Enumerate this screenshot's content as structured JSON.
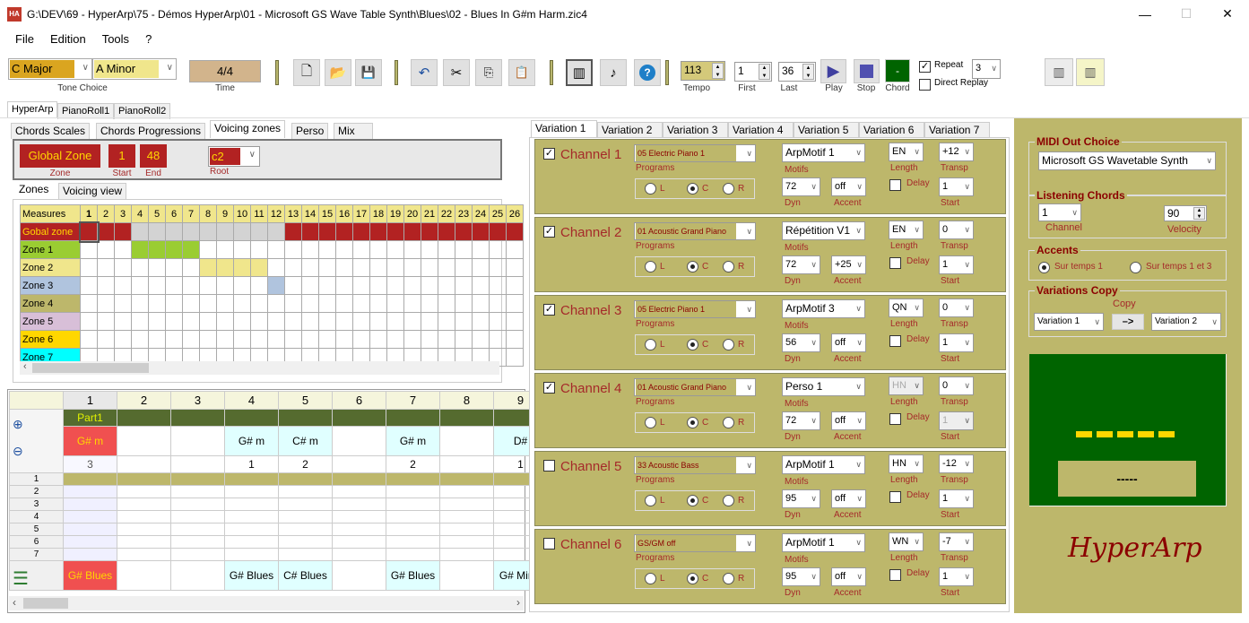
{
  "window": {
    "title": "G:\\DEV\\69 - HyperArp\\75 - Démos HyperArp\\01  - Microsoft GS Wave Table Synth\\Blues\\02 - Blues In G#m Harm.zic4",
    "icon_text": "HA",
    "minimize": "—",
    "maximize": "☐",
    "close": "✕"
  },
  "menu": [
    "File",
    "Edition",
    "Tools",
    "?"
  ],
  "toolbar": {
    "tone_major": "C Major",
    "tone_minor": "A Minor",
    "tone_label": "Tone Choice",
    "time_value": "4/4",
    "time_label": "Time",
    "tempo_value": "113",
    "tempo_label": "Tempo",
    "first_value": "1",
    "first_label": "First",
    "last_value": "36",
    "last_label": "Last",
    "play_label": "Play",
    "stop_label": "Stop",
    "chord_label": "Chord",
    "chord_value": "-",
    "repeat_label": "Repeat",
    "repeat_checked": true,
    "repeat_count": "3",
    "direct_replay_label": "Direct Replay",
    "direct_replay_checked": false
  },
  "main_tabs": [
    "HyperArp",
    "PianoRoll1",
    "PianoRoll2"
  ],
  "sub_tabs": [
    "Chords Scales",
    "Chords Progressions",
    "Voicing zones",
    "Perso",
    "Mix"
  ],
  "voicing": {
    "zone_value": "Global Zone",
    "zone_label": "Zone",
    "start_value": "1",
    "start_label": "Start",
    "end_value": "48",
    "end_label": "End",
    "root_value": "c2",
    "root_label": "Root",
    "view_tabs": [
      "Zones",
      "Voicing view"
    ],
    "measures_label": "Measures",
    "measures": [
      "1",
      "2",
      "3",
      "4",
      "5",
      "6",
      "7",
      "8",
      "9",
      "10",
      "11",
      "12",
      "13",
      "14",
      "15",
      "16",
      "17",
      "18",
      "19",
      "20",
      "21",
      "22",
      "23",
      "24",
      "25",
      "26"
    ],
    "zones": [
      {
        "name": "Gobal zone",
        "color": "#b22222",
        "text_color": "#ffd700",
        "fill": [
          1,
          2,
          3,
          13,
          14,
          15,
          16,
          17,
          18,
          19,
          20,
          21,
          22,
          23,
          24,
          25,
          26
        ],
        "grey": [
          4,
          5,
          6,
          7,
          8,
          9,
          10,
          11,
          12
        ]
      },
      {
        "name": "Zone  1",
        "color": "#9acd32",
        "text_color": "#000",
        "fill": [
          4,
          5,
          6,
          7
        ],
        "grey": []
      },
      {
        "name": "Zone  2",
        "color": "#f0e68c",
        "text_color": "#000",
        "fill": [
          8,
          9,
          10,
          11
        ],
        "grey": []
      },
      {
        "name": "Zone  3",
        "color": "#b0c4de",
        "text_color": "#000",
        "fill": [
          12
        ],
        "grey": []
      },
      {
        "name": "Zone  4",
        "color": "#bdb76b",
        "text_color": "#000",
        "fill": [],
        "grey": []
      },
      {
        "name": "Zone  5",
        "color": "#d8bfd8",
        "text_color": "#000",
        "fill": [],
        "grey": []
      },
      {
        "name": "Zone  6",
        "color": "#ffd700",
        "text_color": "#000",
        "fill": [],
        "grey": []
      },
      {
        "name": "Zone  7",
        "color": "#00ffff",
        "text_color": "#000",
        "fill": [],
        "grey": []
      }
    ]
  },
  "chord_grid": {
    "columns": [
      "1",
      "2",
      "3",
      "4",
      "5",
      "6",
      "7",
      "8",
      "9"
    ],
    "part_label": "Part1",
    "chords": [
      "G# m",
      "",
      "",
      "G# m",
      "C# m",
      "",
      "G# m",
      "",
      "D#"
    ],
    "counts": [
      "3",
      "",
      "",
      "1",
      "2",
      "",
      "2",
      "",
      "1"
    ],
    "rows": [
      "1",
      "2",
      "3",
      "4",
      "5",
      "6",
      "7"
    ],
    "scales": [
      "G# Blues",
      "",
      "",
      "G# Blues",
      "C# Blues",
      "",
      "G# Blues",
      "",
      "G# MinH"
    ]
  },
  "variations": {
    "tabs": [
      "Variation 1",
      "Variation 2",
      "Variation 3",
      "Variation 4",
      "Variation 5",
      "Variation 6",
      "Variation 7"
    ],
    "labels": {
      "programs": "Programs",
      "motifs": "Motifs",
      "length": "Length",
      "transp": "Transp",
      "dyn": "Dyn",
      "accent": "Accent",
      "delay": "Delay",
      "start": "Start",
      "l": "L",
      "c": "C",
      "r": "R"
    },
    "channels": [
      {
        "name": "Channel 1",
        "checked": true,
        "program": "05 Electric Piano 1",
        "motif": "ArpMotif 1",
        "length": "EN",
        "transp": "+12",
        "dyn": "72",
        "accent": "off",
        "start": "1",
        "pan": "C",
        "delay": false,
        "length_disabled": false,
        "start_disabled": false
      },
      {
        "name": "Channel 2",
        "checked": true,
        "program": "01 Acoustic Grand Piano",
        "motif": "Répétition V1",
        "length": "EN",
        "transp": "0",
        "dyn": "72",
        "accent": "+25",
        "start": "1",
        "pan": "C",
        "delay": false,
        "length_disabled": false,
        "start_disabled": false
      },
      {
        "name": "Channel 3",
        "checked": true,
        "program": "05 Electric Piano 1",
        "motif": "ArpMotif 3",
        "length": "QN",
        "transp": "0",
        "dyn": "56",
        "accent": "off",
        "start": "1",
        "pan": "C",
        "delay": false,
        "length_disabled": false,
        "start_disabled": false
      },
      {
        "name": "Channel 4",
        "checked": true,
        "program": "01 Acoustic Grand Piano",
        "motif": "Perso 1",
        "length": "HN",
        "transp": "0",
        "dyn": "72",
        "accent": "off",
        "start": "1",
        "pan": "C",
        "delay": false,
        "length_disabled": true,
        "start_disabled": true
      },
      {
        "name": "Channel 5",
        "checked": false,
        "program": "33 Acoustic Bass",
        "motif": "ArpMotif 1",
        "length": "HN",
        "transp": "-12",
        "dyn": "95",
        "accent": "off",
        "start": "1",
        "pan": "C",
        "delay": false,
        "length_disabled": false,
        "start_disabled": false
      },
      {
        "name": "Channel 6",
        "checked": false,
        "program": "GS/GM off",
        "motif": "ArpMotif 1",
        "length": "WN",
        "transp": "-7",
        "dyn": "95",
        "accent": "off",
        "start": "1",
        "pan": "C",
        "delay": false,
        "length_disabled": false,
        "start_disabled": false
      }
    ]
  },
  "right_panel": {
    "midi_title": "MIDI Out Choice",
    "midi_value": "Microsoft GS Wavetable Synth",
    "listening_title": "Listening Chords",
    "channel_value": "1",
    "channel_label": "Channel",
    "velocity_value": "90",
    "velocity_label": "Velocity",
    "accents_title": "Accents",
    "accent_opt1": "Sur temps 1",
    "accent_opt2": "Sur temps 1 et 3",
    "copy_title": "Variations Copy",
    "copy_label": "Copy",
    "copy_from": "Variation 1",
    "copy_arrow": "–>",
    "copy_to": "Variation 2",
    "display_text": "-----",
    "logo": "HyperArp"
  },
  "colors": {
    "olive": "#bdb76b",
    "dark_red": "#a52a2a",
    "zone_red": "#b22222",
    "display_green": "#006400",
    "part_green": "#556b2f",
    "chord_red": "#f05050",
    "chord_cyan": "#e0ffff"
  }
}
